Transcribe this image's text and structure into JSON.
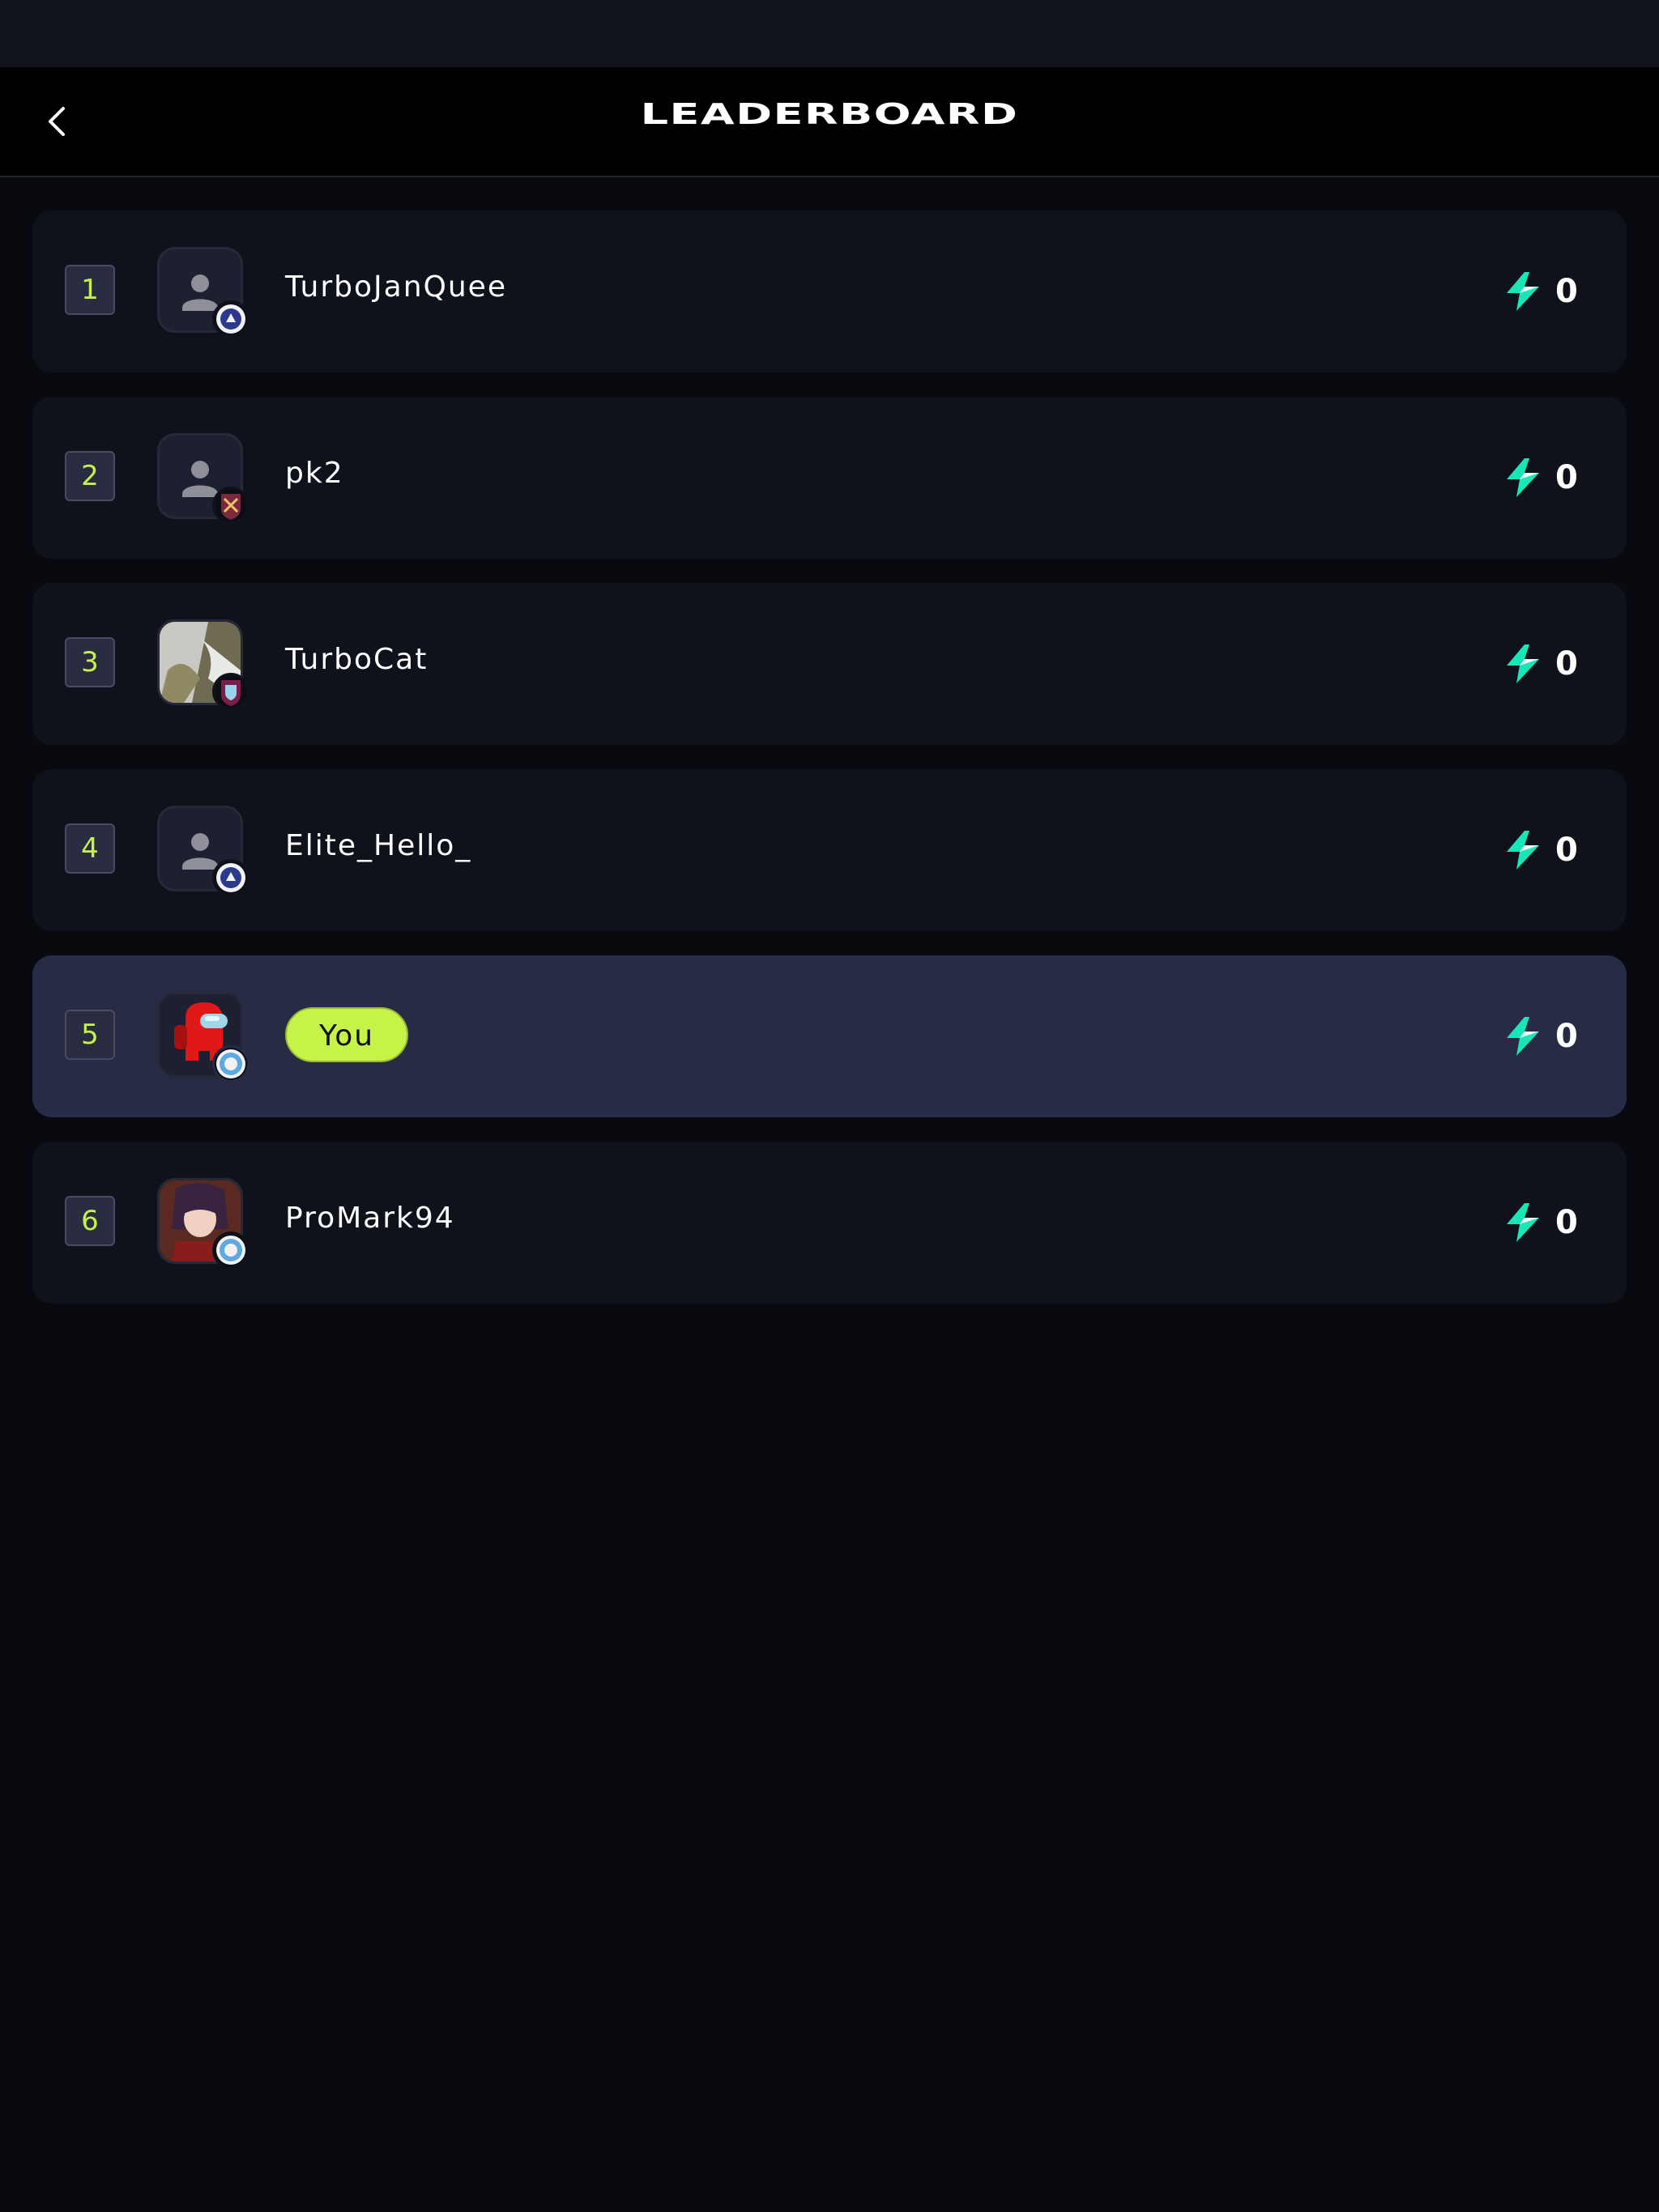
{
  "header": {
    "title": "LEADERBOARD"
  },
  "leaderboard": [
    {
      "rank": "1",
      "name": "TurboJanQuee",
      "points": "0",
      "avatar": "default-avatar",
      "badge": "chelsea-badge"
    },
    {
      "rank": "2",
      "name": "pk2",
      "points": "0",
      "avatar": "default-avatar",
      "badge": "west-ham-badge"
    },
    {
      "rank": "3",
      "name": "TurboCat",
      "points": "0",
      "avatar": "photo-avatar",
      "badge": "burnley-badge"
    },
    {
      "rank": "4",
      "name": "Elite_Hello_",
      "points": "0",
      "avatar": "default-avatar",
      "badge": "chelsea-badge"
    },
    {
      "rank": "5",
      "name": "You",
      "points": "0",
      "avatar": "among-us-avatar",
      "badge": "man-city-badge",
      "is_current_user": true
    },
    {
      "rank": "6",
      "name": "ProMark94",
      "points": "0",
      "avatar": "anime-avatar",
      "badge": "man-city-badge"
    }
  ],
  "colors": {
    "accent": "#c6f347",
    "highlight_row": "#272b45",
    "row": "#10121b",
    "points_icon": "#17e6b6"
  },
  "icons": {
    "back": "chevron-left-icon",
    "points": "lightning-bolt-icon"
  }
}
